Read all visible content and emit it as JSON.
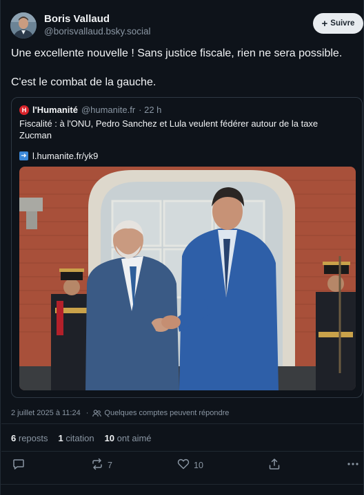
{
  "post": {
    "author_name": "Boris Vallaud",
    "author_handle": "@borisvallaud.bsky.social",
    "follow_label": "Suivre",
    "text_line1": "Une excellente nouvelle ! Sans justice fiscale, rien ne sera possible.",
    "text_line2": "C'est le combat de la gauche.",
    "timestamp": "2 juillet 2025 à 11:24",
    "reply_setting": "Quelques comptes peuvent répondre"
  },
  "embed": {
    "logo_letter": "H",
    "name": "l'Humanité",
    "handle": "@humanite.fr",
    "age": "· 22 h",
    "text": "Fiscalité : à l'ONU, Pedro Sanchez et Lula veulent fédérer autour de la taxe Zucman",
    "link": "l.humanite.fr/yk9"
  },
  "stats": {
    "reposts_count": "6",
    "reposts_label": "reposts",
    "quotes_count": "1",
    "quotes_label": "citation",
    "likes_count": "10",
    "likes_label": "ont aimé"
  },
  "actions": {
    "repost_count": "7",
    "like_count": "10"
  },
  "icons": {
    "reply": "reply-bubble-icon",
    "repost": "repost-arrows-icon",
    "like": "heart-icon",
    "share": "share-icon",
    "more": "more-dots-icon",
    "people": "people-icon",
    "link": "link-arrow-icon"
  },
  "colors": {
    "background": "#0e131a",
    "text": "#f1f3f5",
    "muted": "#8a96a3",
    "embed_border": "#2e3843",
    "follow_bg": "#e8ecf0",
    "logo_red": "#d8232a",
    "link_blue": "#3b88d9"
  }
}
